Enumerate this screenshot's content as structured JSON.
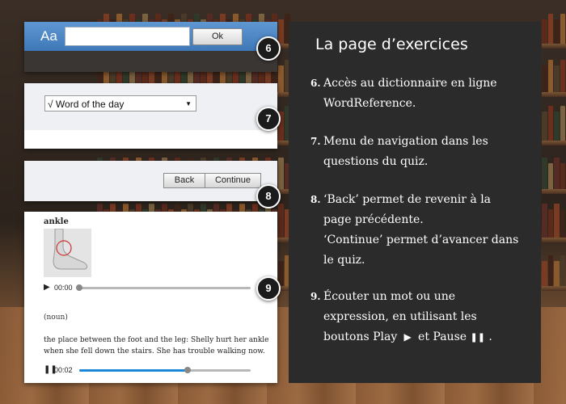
{
  "dictionary_bar": {
    "aa_label": "Aa",
    "ok_label": "Ok",
    "input_value": ""
  },
  "quiz_menu": {
    "selected": "√ Word of the day"
  },
  "nav": {
    "back_label": "Back",
    "continue_label": "Continue"
  },
  "entry": {
    "word": "ankle",
    "player1_time": "00:00",
    "player1_progress": 0.0,
    "part_of_speech": "(noun)",
    "definition": "the place between the foot and the leg: Shelly hurt her ankle when she fell down the stairs. She has trouble walking now.",
    "player2_time": "00:02",
    "player2_progress": 0.63
  },
  "badges": [
    "6",
    "7",
    "8",
    "9"
  ],
  "side": {
    "title": "La page d’exercices",
    "items": [
      {
        "num": "6.",
        "text": "Accès au dictionnaire en ligne WordReference."
      },
      {
        "num": "7.",
        "text": "Menu de navigation dans les questions du quiz."
      },
      {
        "num": "8.",
        "text": "‘Back’ permet de revenir à la page précédente.",
        "text2": "‘Continue’ permet d’avancer dans le quiz."
      },
      {
        "num": "9.",
        "text_a": "Écouter un mot ou une expression, en utilisant les boutons Play",
        "text_b": "et Pause",
        "text_c": "."
      }
    ]
  },
  "icons": {
    "play": "play-icon",
    "pause": "pause-icon",
    "dropdown": "chevron-down-icon"
  },
  "colors": {
    "bar_blue": "#4a86c6",
    "progress_blue": "#1e88d8",
    "side_bg": "#2b2b2b"
  }
}
